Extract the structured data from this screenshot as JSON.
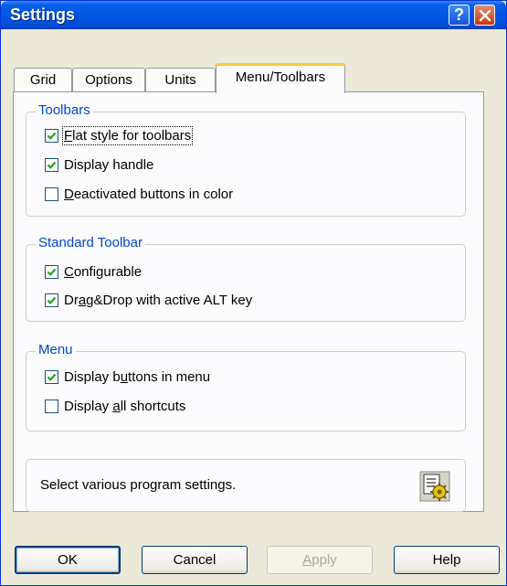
{
  "window": {
    "title": "Settings"
  },
  "title_buttons": {
    "help": "?"
  },
  "tabs": [
    {
      "label": "Grid"
    },
    {
      "label": "Options"
    },
    {
      "label": "Units"
    },
    {
      "label": "Menu/Toolbars",
      "active": true
    }
  ],
  "groups": {
    "toolbars": {
      "title": "Toolbars",
      "items": [
        {
          "pre": "",
          "key": "F",
          "post": "lat style for toolbars",
          "checked": true
        },
        {
          "pre": "Display handle",
          "key": "",
          "post": "",
          "checked": true
        },
        {
          "pre": "",
          "key": "D",
          "post": "eactivated buttons in color",
          "checked": false
        }
      ]
    },
    "standard_toolbar": {
      "title": "Standard Toolbar",
      "items": [
        {
          "pre": "",
          "key": "C",
          "post": "onfigurable",
          "checked": true
        },
        {
          "pre": "Dr",
          "key": "a",
          "post": "g&Drop with active ALT key",
          "checked": true
        }
      ]
    },
    "menu": {
      "title": "Menu",
      "items": [
        {
          "pre": "Display b",
          "key": "u",
          "post": "ttons in menu",
          "checked": true
        },
        {
          "pre": "Display ",
          "key": "a",
          "post": "ll shortcuts",
          "checked": false
        }
      ]
    }
  },
  "info": {
    "text": "Select various program settings.",
    "icon": "settings-gear-icon"
  },
  "buttons": {
    "ok": "OK",
    "cancel": "Cancel",
    "apply_pre": "",
    "apply_key": "A",
    "apply_post": "pply",
    "help": "Help"
  },
  "colors": {
    "group_title": "#0046D5",
    "titlebar": "#0054E3",
    "active_tab_accent": "#FFC83C"
  }
}
